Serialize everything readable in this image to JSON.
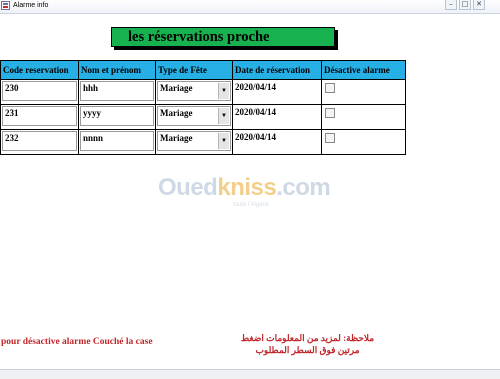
{
  "window": {
    "title": "Alarme info",
    "minimize": "–",
    "maximize": "□",
    "close": "✕"
  },
  "heading": "les réservations proche",
  "table": {
    "headers": [
      "Code reservation",
      "Nom et prénom",
      "Type de Fête",
      "Date de réservation",
      "Désactive alarme"
    ],
    "rows": [
      {
        "code": "230",
        "nom": "hhh",
        "type": "Mariage",
        "date": "2020/04/14",
        "desactive": false
      },
      {
        "code": "231",
        "nom": "yyyy",
        "type": "Mariage",
        "date": "2020/04/14",
        "desactive": false
      },
      {
        "code": "232",
        "nom": "nnnn",
        "type": "Mariage",
        "date": "2020/04/14",
        "desactive": false
      }
    ]
  },
  "watermark": {
    "main": "Oued",
    "accent": "kniss",
    "suffix": ".com",
    "sub": "toute l'Algérie"
  },
  "notes": {
    "left": "pour désactive alarme Couché la  case",
    "right": "ملاحظة: لمزيد من المعلومات اضغط مرتين فوق السطر المطلوب"
  },
  "colors": {
    "heading_bg": "#17b24f",
    "header_bg": "#27b0e6",
    "note_text": "#c0282d"
  },
  "icons": {
    "select_arrow": "▼"
  }
}
